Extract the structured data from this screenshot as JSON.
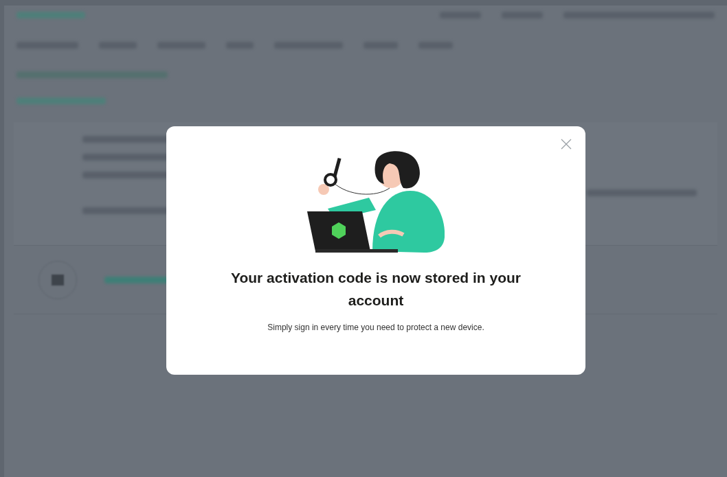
{
  "dialog": {
    "title": "Your activation code is now stored in your account",
    "message": "Simply sign in every time you need to protect a new device."
  }
}
